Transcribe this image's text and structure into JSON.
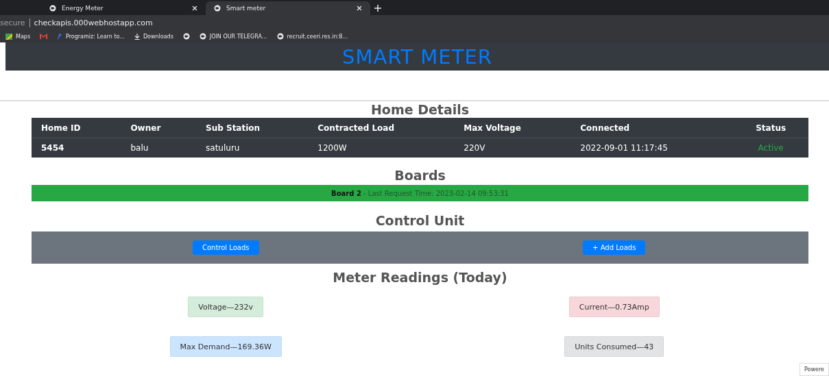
{
  "browser": {
    "tabs": [
      {
        "label": "Energy Meter",
        "selected": false
      },
      {
        "label": "Smart meter",
        "selected": true
      }
    ],
    "address": {
      "prefix": "secure",
      "url": "checkapis.000webhostapp.com"
    },
    "bookmarks": [
      {
        "label": "Maps",
        "kind": "maps"
      },
      {
        "kind": "gmail"
      },
      {
        "label": "Programiz: Learn to...",
        "kind": "programiz"
      },
      {
        "label": "Downloads",
        "kind": "download"
      },
      {
        "kind": "globe"
      },
      {
        "label": "JOIN OUR TELEGRA...",
        "kind": "globe"
      },
      {
        "label": "recruit.ceeri.res.in:8...",
        "kind": "globe"
      }
    ]
  },
  "header": {
    "title": "SMART METER"
  },
  "home_details": {
    "title": "Home Details",
    "columns": [
      "Home ID",
      "Owner",
      "Sub Station",
      "Contracted Load",
      "Max Voltage",
      "Connected",
      "Status"
    ],
    "rows": [
      {
        "cells": [
          "5454",
          "balu",
          "satuluru",
          "1200W",
          "220V",
          "2022-09-01 11:17:45"
        ],
        "status": "Active"
      }
    ]
  },
  "boards": {
    "title": "Boards",
    "items": [
      {
        "name": "Board 2",
        "detail": " - Last Request Time: 2023-02-14 09:53:31"
      }
    ]
  },
  "control_unit": {
    "title": "Control Unit",
    "buttons": [
      "Control Loads",
      "+ Add Loads"
    ]
  },
  "meter_readings": {
    "title": "Meter Readings (Today)",
    "items": [
      {
        "text": "Voltage—232v",
        "color": "#d4edda"
      },
      {
        "text": "Current—0.73Amp",
        "color": "#f8d7da"
      },
      {
        "text": "Max Demand—169.36W",
        "color": "#cce5ff"
      },
      {
        "text": "Units Consumed—43",
        "color": "#e2e3e5"
      }
    ]
  },
  "footer": {
    "badge": "Powere"
  }
}
